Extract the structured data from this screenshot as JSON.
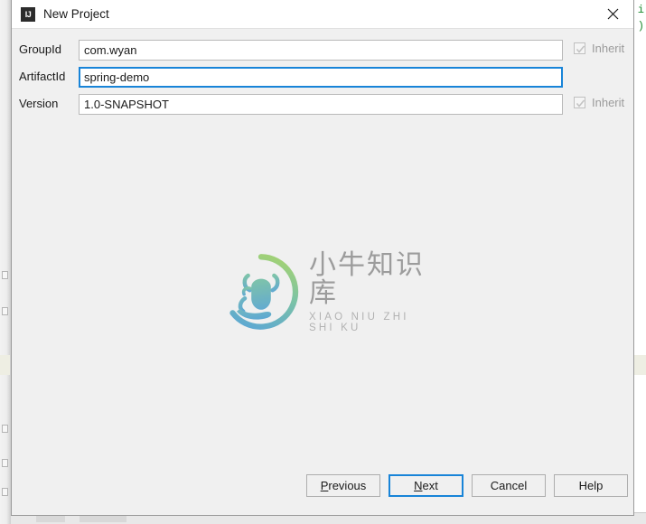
{
  "window": {
    "title": "New Project",
    "app_icon": "IJ",
    "close_icon": "close-icon"
  },
  "form": {
    "rows": [
      {
        "label": "GroupId",
        "value": "com.wyan",
        "focused": false,
        "inherit": {
          "label": "Inherit",
          "checked": true,
          "disabled": true
        }
      },
      {
        "label": "ArtifactId",
        "value": "spring-demo",
        "focused": true,
        "inherit": null
      },
      {
        "label": "Version",
        "value": "1.0-SNAPSHOT",
        "focused": false,
        "inherit": {
          "label": "Inherit",
          "checked": true,
          "disabled": true
        }
      }
    ]
  },
  "watermark": {
    "cn": "小牛知识库",
    "pinyin": "XIAO NIU ZHI SHI KU",
    "logo_icon": "ox-head-circle-logo",
    "color_start": "#8cc96a",
    "color_end": "#5aa7d0"
  },
  "buttons": [
    {
      "label": "Previous",
      "mnemonic": "P",
      "before": "",
      "after": "revious",
      "default": false
    },
    {
      "label": "Next",
      "mnemonic": "N",
      "before": "",
      "after": "ext",
      "default": true
    },
    {
      "label": "Cancel",
      "mnemonic": "",
      "before": "Cancel",
      "after": "",
      "default": false
    },
    {
      "label": "Help",
      "mnemonic": "",
      "before": "Help",
      "after": "",
      "default": false
    }
  ],
  "colors": {
    "dialog_bg": "#f0f0f0",
    "focus_blue": "#1884d8",
    "titlebar_bg": "#ffffff",
    "disabled_text": "#9b9b9b"
  }
}
